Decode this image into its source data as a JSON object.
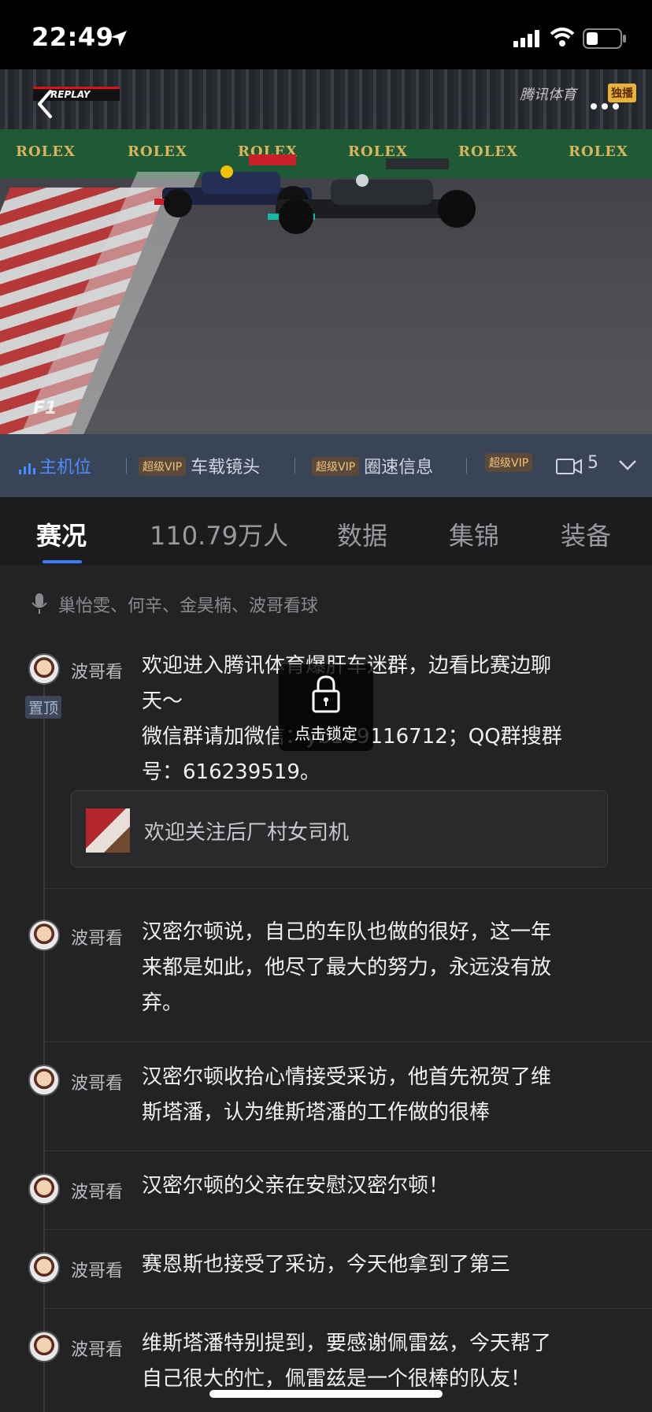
{
  "status_bar": {
    "time": "22:49"
  },
  "video": {
    "replay_label": "REPLAY",
    "brand": "腾讯体育",
    "brand_tag": "独播",
    "sponsor": "ROLEX",
    "logo": "F1"
  },
  "camera_bar": {
    "items": [
      {
        "label": "主机位",
        "vip": ""
      },
      {
        "label": "车载镜头",
        "vip": "超级VIP"
      },
      {
        "label": "圈速信息",
        "vip": "超级VIP"
      },
      {
        "label": "",
        "vip": "超级VIP"
      }
    ],
    "count": "5"
  },
  "tabs": [
    {
      "label": "赛况",
      "active": true
    },
    {
      "label": "110.79万人"
    },
    {
      "label": "数据"
    },
    {
      "label": "集锦"
    },
    {
      "label": "装备"
    }
  ],
  "feed": {
    "commentators": "巢怡雯、何辛、金昊楠、波哥看球",
    "pinned": {
      "author": "波哥看",
      "pin_label": "置顶",
      "line1": "欢迎进入腾讯体育爆肝车迷群，边看比赛边聊",
      "line2": "天～",
      "line3": "微信群请加微信：yb109116712；QQ群搜群",
      "line4": "号：616239519。",
      "card_text": "欢迎关注后厂村女司机"
    },
    "posts": [
      {
        "author": "波哥看",
        "lines": [
          "汉密尔顿说，自己的车队也做的很好，这一年",
          "来都是如此，他尽了最大的努力，永远没有放",
          "弃。"
        ]
      },
      {
        "author": "波哥看",
        "lines": [
          "汉密尔顿收拾心情接受采访，他首先祝贺了维",
          "斯塔潘，认为维斯塔潘的工作做的很棒"
        ]
      },
      {
        "author": "波哥看",
        "lines": [
          "汉密尔顿的父亲在安慰汉密尔顿！"
        ]
      },
      {
        "author": "波哥看",
        "lines": [
          "赛恩斯也接受了采访，今天他拿到了第三"
        ]
      },
      {
        "author": "波哥看",
        "lines": [
          "维斯塔潘特别提到，要感谢佩雷兹，今天帮了",
          "自己很大的忙，佩雷兹是一个很棒的队友！"
        ]
      }
    ]
  },
  "lock_overlay": {
    "label": "点击锁定"
  }
}
